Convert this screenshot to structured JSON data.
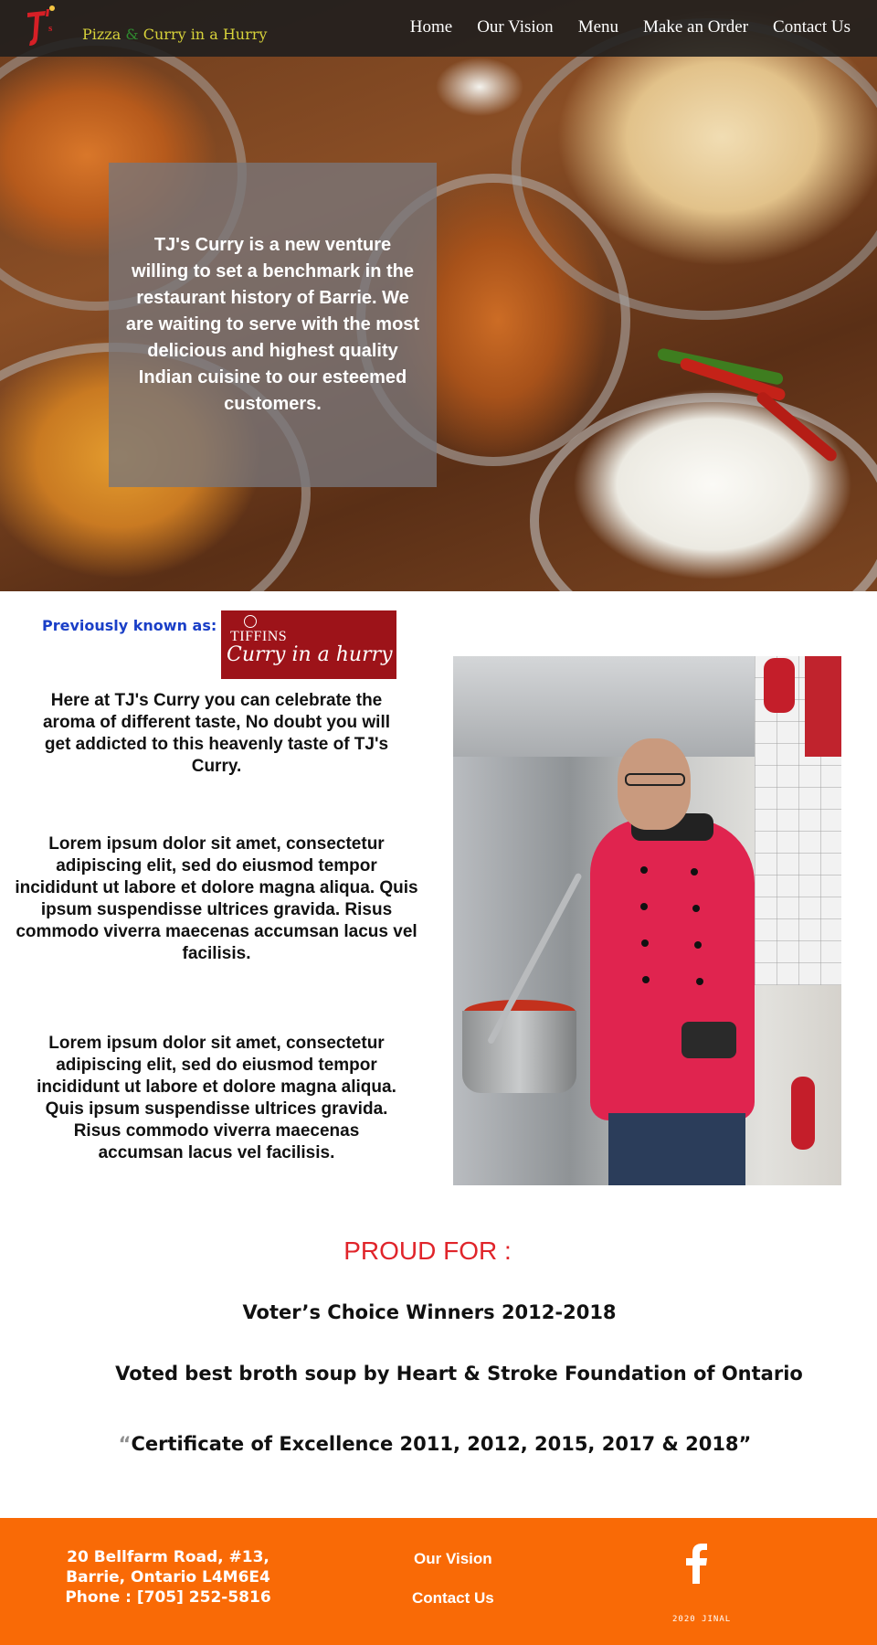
{
  "header": {
    "logo_text": "TJ's",
    "brand": {
      "part1": "Pizza",
      "amp": "&",
      "part2": "Curry in a Hurry"
    },
    "nav": [
      {
        "label": "Home"
      },
      {
        "label": "Our Vision"
      },
      {
        "label": "Menu"
      },
      {
        "label": "Make an Order"
      },
      {
        "label": "Contact Us"
      }
    ]
  },
  "hero": {
    "text": "TJ's Curry is a new venture willing to set a benchmark in the restaurant history of Barrie. We are waiting to serve with the most delicious and highest quality Indian cuisine to our esteemed customers."
  },
  "about": {
    "previously_label": "Previously known as:",
    "old_logo": {
      "small": "TIFFINS",
      "script": "Curry in a hurry"
    },
    "paragraphs": [
      "Here at TJ's Curry you can celebrate the aroma of different taste, No doubt you will get addicted to this heavenly taste of TJ's Curry.",
      "Lorem ipsum dolor sit amet, consectetur adipiscing elit, sed do eiusmod tempor incididunt ut labore et dolore magna aliqua. Quis ipsum suspendisse ultrices gravida. Risus commodo viverra maecenas accumsan lacus vel facilisis.",
      "Lorem ipsum dolor sit amet, consectetur adipiscing elit, sed do eiusmod tempor incididunt ut labore et dolore magna aliqua. Quis ipsum suspendisse ultrices gravida. Risus commodo viverra maecenas accumsan lacus vel facilisis."
    ]
  },
  "proud": {
    "title": "PROUD FOR :",
    "awards": [
      "Voter’s Choice Winners 2012-2018",
      "Voted best broth soup by Heart & Stroke Foundation of Ontario"
    ],
    "certificate": {
      "open_quote": "“",
      "text": "Certificate of Excellence 2011, 2012, 2015, 2017 & 2018”"
    }
  },
  "footer": {
    "address_line1": "20 Bellfarm Road, #13,",
    "address_line2": "Barrie, Ontario L4M6E4",
    "phone": "Phone : [705] 252-5816",
    "links": [
      {
        "label": "Our Vision"
      },
      {
        "label": "Contact Us"
      }
    ],
    "social_icon": "facebook-icon",
    "copyright": "2020 JINAL"
  },
  "colors": {
    "footer_bg": "#f96a06",
    "proud_title": "#e0242a",
    "previously_label": "#1a3fc7",
    "brand_text": "#d7d23a",
    "tiffins_bg": "#9d1319"
  }
}
